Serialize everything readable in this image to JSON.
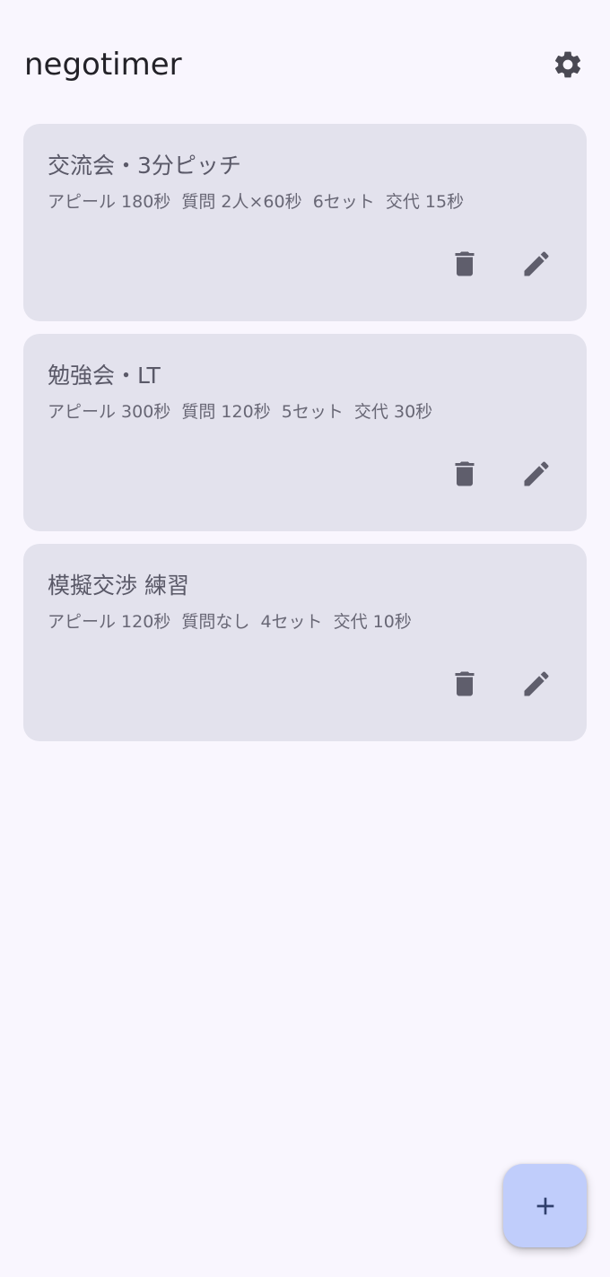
{
  "app": {
    "title": "negotimer",
    "settings_icon": "gear-icon"
  },
  "presets": [
    {
      "title": "交流会・3分ピッチ",
      "summary": "アピール 180秒  質問 2人×60秒  6セット  交代 15秒",
      "delete_icon": "trash-icon",
      "edit_icon": "pencil-icon"
    },
    {
      "title": "勉強会・LT",
      "summary": "アピール 300秒  質問 120秒  5セット  交代 30秒",
      "delete_icon": "trash-icon",
      "edit_icon": "pencil-icon"
    },
    {
      "title": "模擬交渉 練習",
      "summary": "アピール 120秒  質問なし  4セット  交代 10秒",
      "delete_icon": "trash-icon",
      "edit_icon": "pencil-icon"
    }
  ],
  "fab": {
    "icon": "plus-icon"
  },
  "colors": {
    "background": "#f9f6fe",
    "card": "#e3e2ed",
    "icon": "#5f5e6c",
    "fab": "#c0cdfb",
    "fab_icon": "#2f3f6c"
  }
}
